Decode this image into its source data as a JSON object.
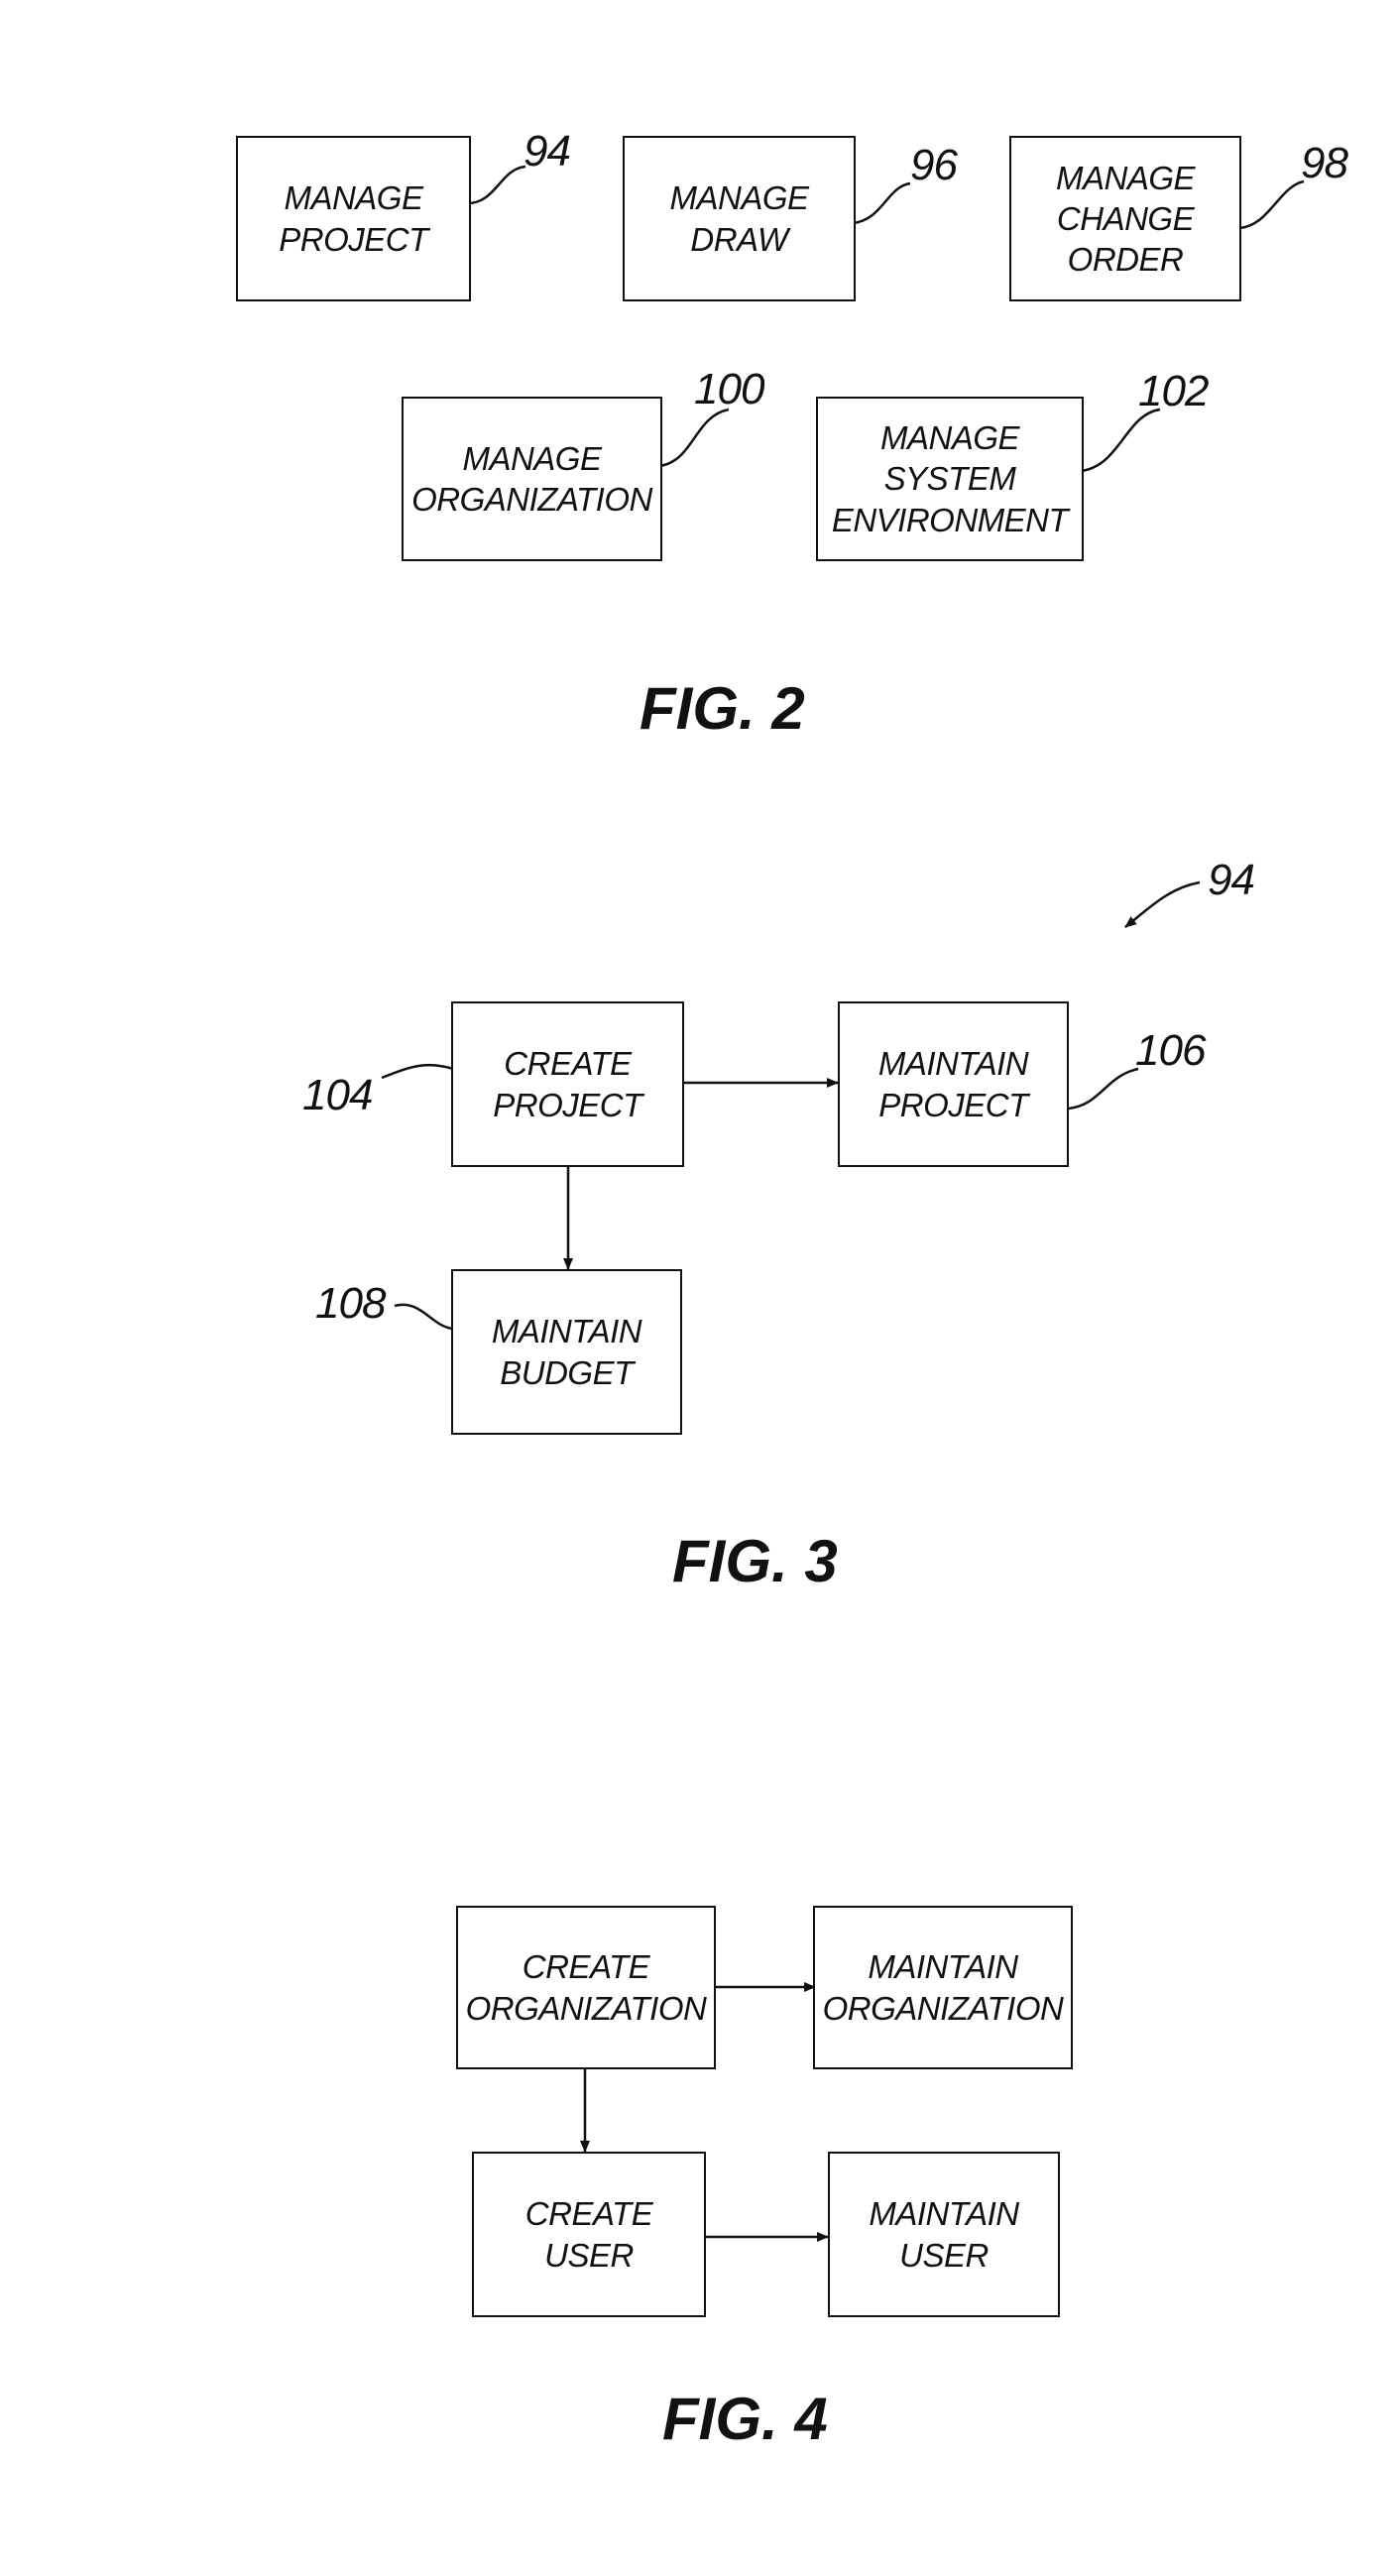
{
  "fig2": {
    "caption": "FIG. 2",
    "boxes": [
      {
        "label": "MANAGE\nPROJECT",
        "ref": "94"
      },
      {
        "label": "MANAGE\nDRAW",
        "ref": "96"
      },
      {
        "label": "MANAGE\nCHANGE\nORDER",
        "ref": "98"
      },
      {
        "label": "MANAGE\nORGANIZATION",
        "ref": "100"
      },
      {
        "label": "MANAGE\nSYSTEM\nENVIRONMENT",
        "ref": "102"
      }
    ]
  },
  "fig3": {
    "caption": "FIG. 3",
    "ref": "94",
    "boxes": [
      {
        "label": "CREATE\nPROJECT",
        "ref": "104"
      },
      {
        "label": "MAINTAIN\nPROJECT",
        "ref": "106"
      },
      {
        "label": "MAINTAIN\nBUDGET",
        "ref": "108"
      }
    ]
  },
  "fig4": {
    "caption": "FIG. 4",
    "boxes": [
      {
        "label": "CREATE\nORGANIZATION"
      },
      {
        "label": "MAINTAIN\nORGANIZATION"
      },
      {
        "label": "CREATE\nUSER"
      },
      {
        "label": "MAINTAIN\nUSER"
      }
    ]
  }
}
